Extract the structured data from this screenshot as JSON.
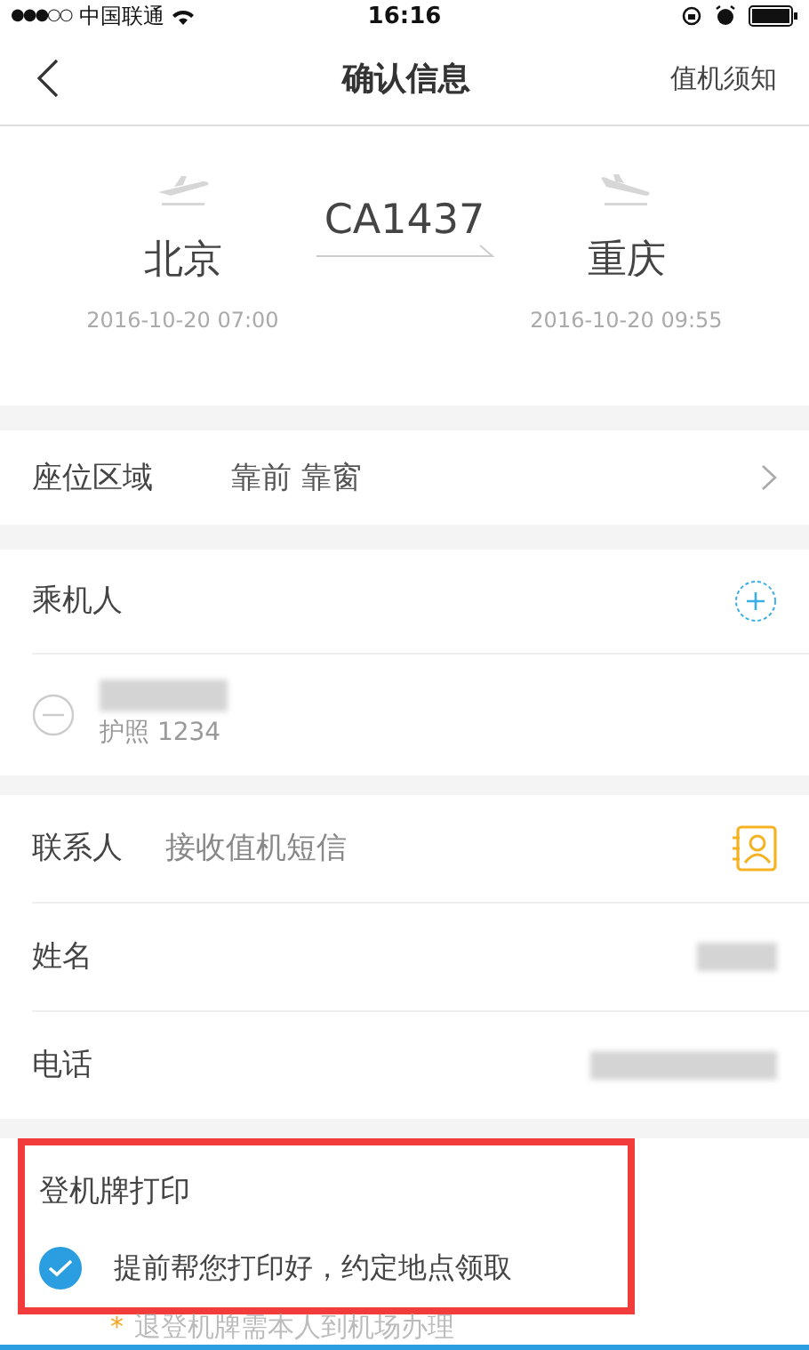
{
  "status_bar": {
    "signal": "●●●○○",
    "carrier": "中国联通",
    "time": "16:16"
  },
  "nav": {
    "title": "确认信息",
    "action": "值机须知"
  },
  "flight": {
    "number": "CA1437",
    "from": {
      "city": "北京",
      "time": "2016-10-20 07:00"
    },
    "to": {
      "city": "重庆",
      "time": "2016-10-20 09:55"
    }
  },
  "seat": {
    "label": "座位区域",
    "value": "靠前 靠窗"
  },
  "passengers": {
    "title": "乘机人",
    "items": [
      {
        "document": "护照 1234"
      }
    ]
  },
  "contact": {
    "label": "联系人",
    "hint": "接收值机短信",
    "fields": [
      {
        "label": "姓名",
        "kind": "short"
      },
      {
        "label": "电话",
        "kind": "long"
      }
    ]
  },
  "boarding": {
    "title": "登机牌打印",
    "option": {
      "text": "提前帮您打印好，约定地点领取",
      "checked": true
    },
    "note_mark": "*",
    "note": "退登机牌需本人到机场办理",
    "highlighted": true
  }
}
